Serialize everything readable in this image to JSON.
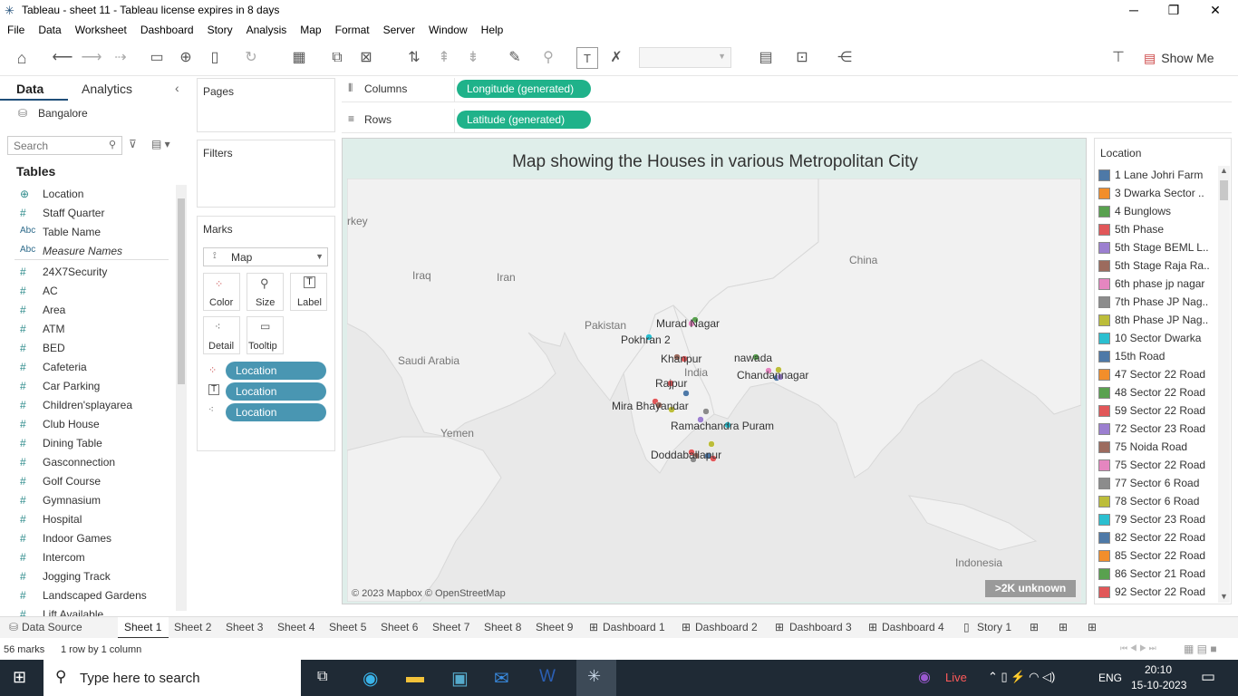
{
  "window": {
    "title": "Tableau - sheet 11 - Tableau license expires in 8 days",
    "minimize": "─",
    "restore": "❐",
    "close": "✕"
  },
  "menu": [
    "File",
    "Data",
    "Worksheet",
    "Dashboard",
    "Story",
    "Analysis",
    "Map",
    "Format",
    "Server",
    "Window",
    "Help"
  ],
  "toolbar": {
    "show_me": "Show Me"
  },
  "side": {
    "tab_data": "Data",
    "tab_analytics": "Analytics",
    "datasource": "Bangalore",
    "search_placeholder": "Search",
    "tables_header": "Tables",
    "fields": [
      {
        "icon": "globe",
        "type": "⊕",
        "name": "Location"
      },
      {
        "icon": "hash",
        "type": "#",
        "name": "Staff Quarter"
      },
      {
        "icon": "abc",
        "type": "Abc",
        "name": "Table Name"
      },
      {
        "icon": "abc",
        "type": "Abc",
        "name": "Measure Names"
      },
      {
        "icon": "hash",
        "type": "#",
        "name": "24X7Security"
      },
      {
        "icon": "hash",
        "type": "#",
        "name": "AC"
      },
      {
        "icon": "hash",
        "type": "#",
        "name": "Area"
      },
      {
        "icon": "hash",
        "type": "#",
        "name": "ATM"
      },
      {
        "icon": "hash",
        "type": "#",
        "name": "BED"
      },
      {
        "icon": "hash",
        "type": "#",
        "name": "Cafeteria"
      },
      {
        "icon": "hash",
        "type": "#",
        "name": "Car Parking"
      },
      {
        "icon": "hash",
        "type": "#",
        "name": "Children'splayarea"
      },
      {
        "icon": "hash",
        "type": "#",
        "name": "Club House"
      },
      {
        "icon": "hash",
        "type": "#",
        "name": "Dining Table"
      },
      {
        "icon": "hash",
        "type": "#",
        "name": "Gasconnection"
      },
      {
        "icon": "hash",
        "type": "#",
        "name": "Golf Course"
      },
      {
        "icon": "hash",
        "type": "#",
        "name": "Gymnasium"
      },
      {
        "icon": "hash",
        "type": "#",
        "name": "Hospital"
      },
      {
        "icon": "hash",
        "type": "#",
        "name": "Indoor Games"
      },
      {
        "icon": "hash",
        "type": "#",
        "name": "Intercom"
      },
      {
        "icon": "hash",
        "type": "#",
        "name": "Jogging Track"
      },
      {
        "icon": "hash",
        "type": "#",
        "name": "Landscaped Gardens"
      },
      {
        "icon": "hash",
        "type": "#",
        "name": "Lift Available"
      }
    ]
  },
  "cards": {
    "pages": "Pages",
    "filters": "Filters",
    "marks": "Marks",
    "mark_type": "Map",
    "color": "Color",
    "size": "Size",
    "label": "Label",
    "detail": "Detail",
    "tooltip": "Tooltip",
    "mark_pills": [
      "Location",
      "Location",
      "Location"
    ]
  },
  "shelves": {
    "columns_label": "Columns",
    "rows_label": "Rows",
    "columns_pill": "Longitude (generated)",
    "rows_pill": "Latitude (generated)"
  },
  "view": {
    "title": "Map showing the Houses in various Metropolitan City",
    "attribution": "© 2023 Mapbox © OpenStreetMap",
    "unknown_badge": ">2K unknown",
    "geo_labels": [
      "rkey",
      "Iraq",
      "Iran",
      "Pakistan",
      "China",
      "Saudi Arabia",
      "India",
      "Yemen",
      "Indonesia"
    ],
    "place_labels": [
      "Murad Nagar",
      "Pokhran 2",
      "Khanpur",
      "nawada",
      "Chandannagar",
      "Rajpur",
      "Mira Bhayandar",
      "Ramachandra Puram",
      "Doddaballapur"
    ]
  },
  "legend": {
    "title": "Location",
    "items": [
      {
        "label": "1 Lane Johri Farm",
        "color": "#4e79a7"
      },
      {
        "label": "3 Dwarka Sector ..",
        "color": "#f28e2b"
      },
      {
        "label": "4 Bunglows",
        "color": "#59a14f"
      },
      {
        "label": "5th Phase",
        "color": "#e15759"
      },
      {
        "label": "5th Stage BEML L..",
        "color": "#9c7fd0"
      },
      {
        "label": "5th Stage Raja Ra..",
        "color": "#9c6b5e"
      },
      {
        "label": "6th phase jp nagar",
        "color": "#e586c0"
      },
      {
        "label": "7th Phase JP Nag..",
        "color": "#8c8c8c"
      },
      {
        "label": "8th Phase JP Nag..",
        "color": "#bcbd3a"
      },
      {
        "label": "10 Sector Dwarka",
        "color": "#2bbfd0"
      },
      {
        "label": "15th Road",
        "color": "#4e79a7"
      },
      {
        "label": "47 Sector 22 Road",
        "color": "#f28e2b"
      },
      {
        "label": "48 Sector 22 Road",
        "color": "#59a14f"
      },
      {
        "label": "59 Sector 22 Road",
        "color": "#e15759"
      },
      {
        "label": "72 Sector 23 Road",
        "color": "#9c7fd0"
      },
      {
        "label": "75 Noida Road",
        "color": "#9c6b5e"
      },
      {
        "label": "75 Sector 22 Road",
        "color": "#e586c0"
      },
      {
        "label": "77 Sector 6 Road",
        "color": "#8c8c8c"
      },
      {
        "label": "78 Sector 6 Road",
        "color": "#bcbd3a"
      },
      {
        "label": "79 Sector 23 Road",
        "color": "#2bbfd0"
      },
      {
        "label": "82 Sector 22 Road",
        "color": "#4e79a7"
      },
      {
        "label": "85 Sector 22 Road",
        "color": "#f28e2b"
      },
      {
        "label": "86 Sector 21 Road",
        "color": "#59a14f"
      },
      {
        "label": "92 Sector 22 Road",
        "color": "#e15759"
      }
    ]
  },
  "tabs": {
    "datasource": "Data Source",
    "sheets": [
      "Sheet 1",
      "Sheet 2",
      "Sheet 3",
      "Sheet 4",
      "Sheet 5",
      "Sheet 6",
      "Sheet 7",
      "Sheet 8",
      "Sheet 9"
    ],
    "dashboards": [
      "Dashboard 1",
      "Dashboard 2",
      "Dashboard 3",
      "Dashboard 4"
    ],
    "story": "Story 1"
  },
  "status": {
    "marks": "56 marks",
    "dims": "1 row by 1 column"
  },
  "taskbar": {
    "search": "Type here to search",
    "live": "Live",
    "lang": "ENG",
    "time": "20:10",
    "date": "15-10-2023"
  },
  "colors": {
    "accent_pill": "#1fb28a",
    "mark_pill": "#4996b2"
  }
}
